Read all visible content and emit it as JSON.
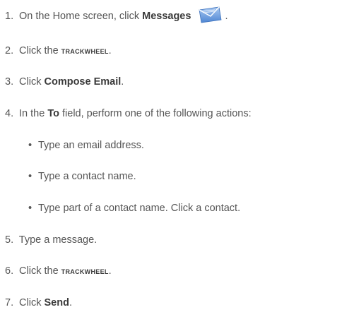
{
  "steps": [
    {
      "num": "1.",
      "pre": "On the Home screen, click ",
      "bold": "Messages",
      "post": " ."
    },
    {
      "num": "2.",
      "pre": "Click the ",
      "smallcaps": "trackwheel",
      "post": "."
    },
    {
      "num": "3.",
      "pre": "Click ",
      "bold": "Compose Email",
      "post": "."
    },
    {
      "num": "4.",
      "pre": "In the ",
      "bold": "To",
      "post": " field, perform one of the following actions:"
    },
    {
      "num": "5.",
      "text": "Type a message."
    },
    {
      "num": "6.",
      "pre": "Click the ",
      "smallcaps": "trackwheel",
      "post": "."
    },
    {
      "num": "7.",
      "pre": "Click ",
      "bold": "Send",
      "post": "."
    }
  ],
  "bullets": [
    "Type an email address.",
    "Type a contact name.",
    "Type part of a contact name. Click a contact."
  ],
  "bullet_glyph": "•",
  "icons": {
    "messages": "envelope-icon",
    "accent_color": "#5b8fd6"
  }
}
